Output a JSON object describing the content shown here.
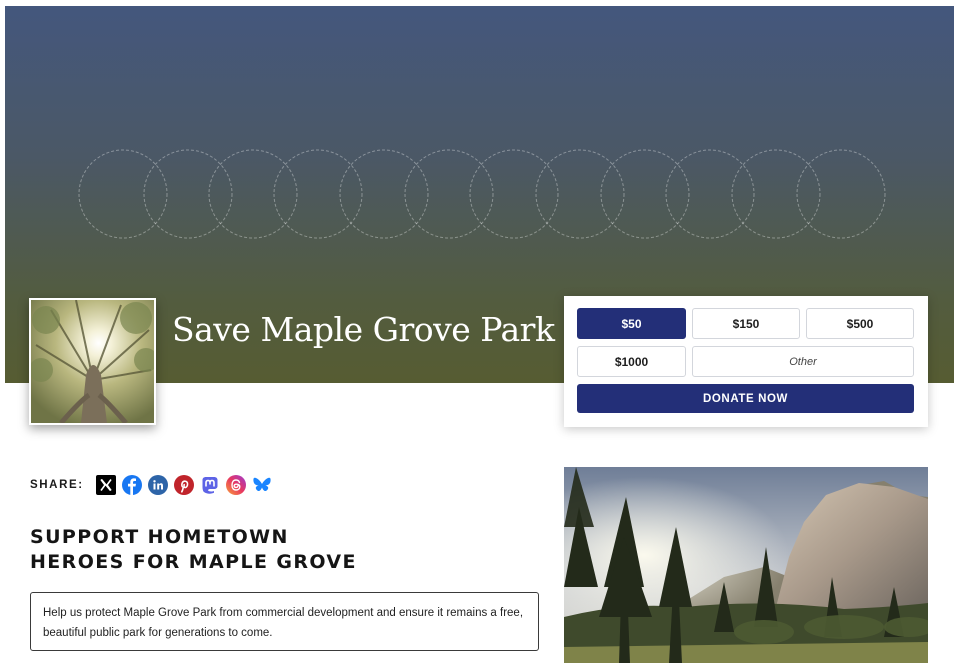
{
  "campaign": {
    "title": "Save Maple Grove Park",
    "avatar_icon": "tree-photo",
    "cover": "gradient-with-rings"
  },
  "donate": {
    "amounts": [
      {
        "label": "$50",
        "selected": true
      },
      {
        "label": "$150",
        "selected": false
      },
      {
        "label": "$500",
        "selected": false
      },
      {
        "label": "$1000",
        "selected": false
      }
    ],
    "other_label": "Other",
    "button_label": "DONATE NOW",
    "accent_color": "#232f78"
  },
  "share": {
    "label": "SHARE:",
    "networks": [
      "x-icon",
      "facebook-icon",
      "linkedin-icon",
      "pinterest-icon",
      "mastodon-icon",
      "threads-icon",
      "bluesky-icon"
    ]
  },
  "headline": {
    "line1": "SUPPORT HOMETOWN",
    "line2": "HEROES FOR MAPLE GROVE"
  },
  "description": "Help us protect Maple Grove Park from commercial development and ensure it remains a free, beautiful public park for generations to come.",
  "photo": {
    "subject": "granite-cliff-and-pine-forest-photo"
  }
}
